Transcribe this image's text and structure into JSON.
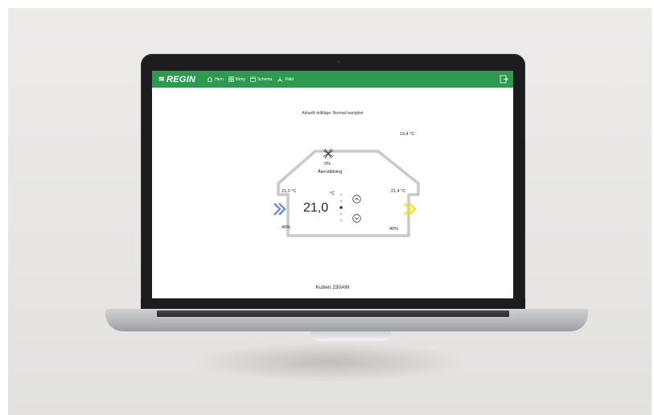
{
  "app": {
    "brand": "REGIN",
    "nav": [
      {
        "label": "Hem",
        "icon": "home-icon"
      },
      {
        "label": "Meny",
        "icon": "grid-icon"
      },
      {
        "label": "Schema",
        "icon": "calendar-icon"
      },
      {
        "label": "Fläkt",
        "icon": "fan-icon"
      }
    ]
  },
  "dashboard": {
    "status_text": "Aktuellt driftläge: Normal hastighet",
    "outdoor_temp": "19,4 °C",
    "heat_recovery_percent": "0%",
    "heat_recovery_label": "Återstållning",
    "supply_in_temp": "21,0 °C",
    "supply_in_percent": "40%",
    "setpoint_unit": "°C",
    "setpoint_value": "21,0",
    "exhaust_temp": "21,4 °C",
    "exhaust_percent": "40%",
    "model_name": "Kuben 230AW"
  },
  "colors": {
    "topbar": "#2e9a50",
    "supply_arrow": "#6b8fcf",
    "exhaust_arrow": "#f2e22a",
    "house_outline": "#c9c9c9"
  }
}
